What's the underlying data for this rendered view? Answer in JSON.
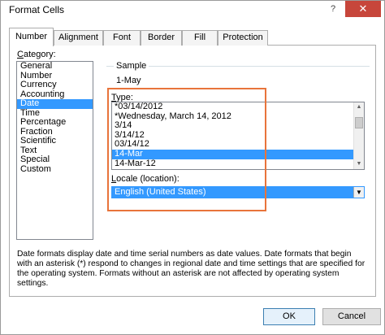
{
  "window": {
    "title": "Format Cells",
    "help_label": "?",
    "close_label": "✕"
  },
  "tabs": [
    {
      "label": "Number",
      "active": true
    },
    {
      "label": "Alignment",
      "active": false
    },
    {
      "label": "Font",
      "active": false
    },
    {
      "label": "Border",
      "active": false
    },
    {
      "label": "Fill",
      "active": false
    },
    {
      "label": "Protection",
      "active": false
    }
  ],
  "category": {
    "label_prefix": "",
    "label_mnemonic": "C",
    "label_rest": "ategory:",
    "items": [
      "General",
      "Number",
      "Currency",
      "Accounting",
      "Date",
      "Time",
      "Percentage",
      "Fraction",
      "Scientific",
      "Text",
      "Special",
      "Custom"
    ],
    "selected": "Date"
  },
  "sample": {
    "label": "Sample",
    "value": "1-May"
  },
  "type": {
    "label_mnemonic": "T",
    "label_rest": "ype:",
    "items": [
      "*03/14/2012",
      "*Wednesday, March 14, 2012",
      "3/14",
      "3/14/12",
      "03/14/12",
      "14-Mar",
      "14-Mar-12"
    ],
    "selected": "14-Mar"
  },
  "locale": {
    "label_mnemonic": "L",
    "label_rest": "ocale (location):",
    "value": "English (United States)"
  },
  "description": "Date formats display date and time serial numbers as date values.  Date formats that begin with an asterisk (*) respond to changes in regional date and time settings that are specified for the operating system. Formats without an asterisk are not affected by operating system settings.",
  "buttons": {
    "ok": "OK",
    "cancel": "Cancel"
  },
  "colors": {
    "selection": "#3399ff",
    "highlight_box": "#e8743b",
    "close_button": "#c7463b"
  }
}
